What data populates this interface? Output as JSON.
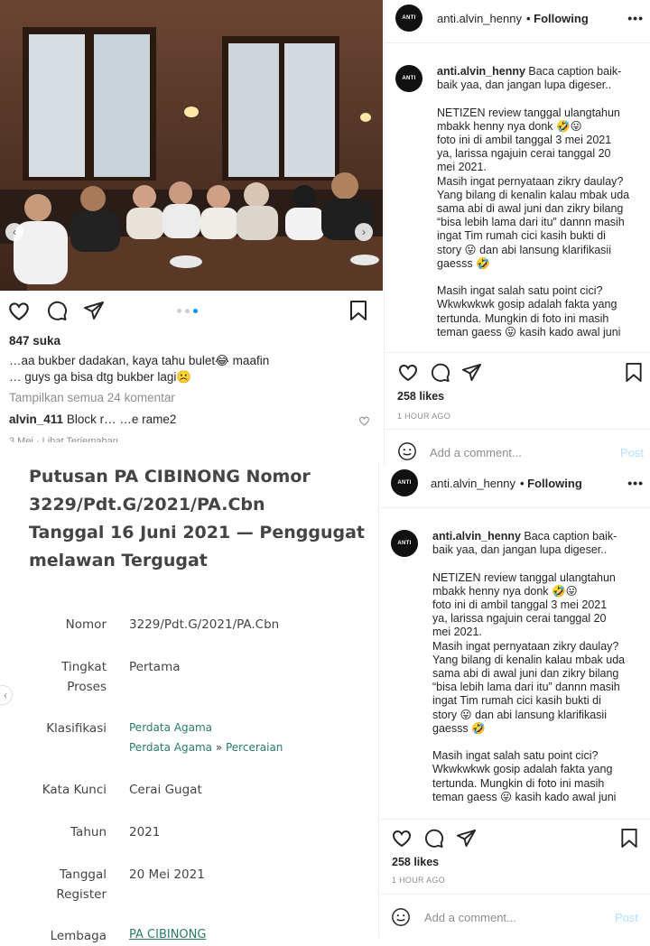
{
  "top_left_post": {
    "likes": "847 suka",
    "caption_line1": "…aa bukber dadakan, kaya tahu bulet😂 maafin",
    "caption_line2": "… guys ga bisa dtg bukber lagi☹️",
    "view_comments": "Tampilkan semua 24 komentar",
    "comment_user": "alvin_411",
    "comment_text": "Block r…  …e rame2",
    "footer_text": "3 Mei · Lihat Terjemahan"
  },
  "post_a": {
    "username": "anti.alvin_henny",
    "following": "• Following",
    "avatar_text": "ANTI",
    "caption_user": "anti.alvin_henny",
    "caption": " Baca caption baik-\nbaik yaa, dan jangan lupa digeser..\n\nNETIZEN review tanggal ulangtahun\nmbakk henny nya donk 🤣😛\nfoto ini di ambil tanggal 3 mei 2021\nya, larissa ngajuin cerai tanggal 20\nmei 2021.\nMasih ingat pernyataan zikry daulay?\nYang bilang di kenalin kalau mbak uda\nsama abi di awal juni dan zikry bilang\n“bisa lebih lama dari itu” dannn masih\ningat Tim rumah cici kasih bukti di\nstory 😛 dan abi lansung klarifikasii\ngaesss 🤣\n\nMasih ingat salah satu point cici?\nWkwkwkwk gosip adalah fakta yang\ntertunda. Mungkin di foto ini masih\nteman gaess 😛 kasih kado awal juni",
    "likes": "258 likes",
    "time": "1 HOUR AGO",
    "add_comment": "Add a comment...",
    "post_btn": "Post"
  },
  "post_b": {
    "username": "anti.alvin_henny",
    "following": "• Following",
    "avatar_text": "ANTI",
    "caption_user": "anti.alvin_henny",
    "caption": " Baca caption baik-\nbaik yaa, dan jangan lupa digeser..\n\nNETIZEN review tanggal ulangtahun\nmbakk henny nya donk 🤣😛\nfoto ini di ambil tanggal 3 mei 2021\nya, larissa ngajuin cerai tanggal 20\nmei 2021.\nMasih ingat pernyataan zikry daulay?\nYang bilang di kenalin kalau mbak uda\nsama abi di awal juni dan zikry bilang\n“bisa lebih lama dari itu” dannn masih\ningat Tim rumah cici kasih bukti di\nstory 😛 dan abi lansung klarifikasii\ngaesss 🤣\n\nMasih ingat salah satu point cici?\nWkwkwkwk gosip adalah fakta yang\ntertunda. Mungkin di foto ini masih\nteman gaess 😛 kasih kado awal juni",
    "likes": "258 likes",
    "time": "1 HOUR AGO",
    "add_comment": "Add a comment...",
    "post_btn": "Post"
  },
  "document": {
    "title_lines": [
      "Putusan PA CIBINONG Nomor",
      "3229/Pdt.G/2021/PA.Cbn",
      "Tanggal 16 Juni 2021 — Penggugat",
      "melawan Tergugat"
    ],
    "rows": {
      "nomor_label": "Nomor",
      "nomor_value": "3229/Pdt.G/2021/PA.Cbn",
      "tingkat_label1": "Tingkat",
      "tingkat_label2": "Proses",
      "tingkat_value": "Pertama",
      "klasifikasi_label": "Klasifikasi",
      "klasifikasi_link1": "Perdata Agama",
      "klasifikasi_link2a": "Perdata Agama",
      "klasifikasi_sep": "»",
      "klasifikasi_link2b": "Perceraian",
      "katakunci_label": "Kata Kunci",
      "katakunci_value": "Cerai Gugat",
      "tahun_label": "Tahun",
      "tahun_value": "2021",
      "tanggal_label1": "Tanggal",
      "tanggal_label2": "Register",
      "tanggal_value": "20 Mei 2021",
      "lembaga_label": "Lembaga",
      "lembaga_value": "PA CIBINONG"
    }
  }
}
